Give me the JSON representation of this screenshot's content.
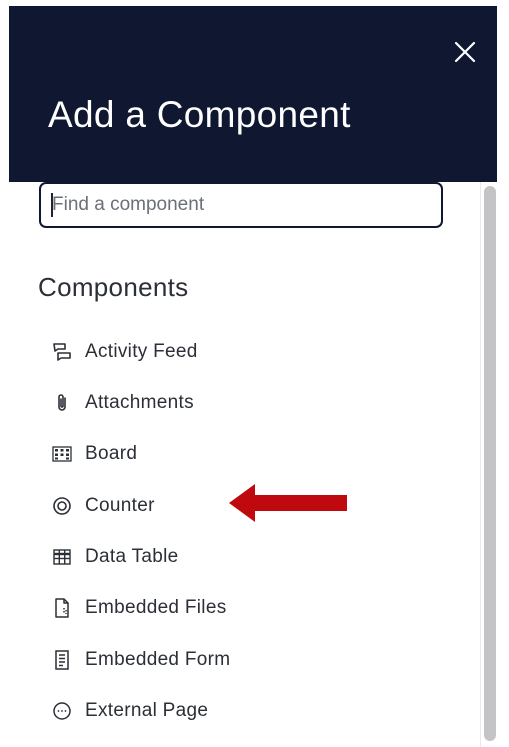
{
  "panel": {
    "title": "Add a Component",
    "close_icon": "close-icon",
    "header_color": "#0f1830"
  },
  "search": {
    "placeholder": "Find a component",
    "value": ""
  },
  "section": {
    "title": "Components"
  },
  "components": [
    {
      "label": "Activity Feed",
      "icon": "activity-feed-icon"
    },
    {
      "label": "Attachments",
      "icon": "paperclip-icon"
    },
    {
      "label": "Board",
      "icon": "board-icon"
    },
    {
      "label": "Counter",
      "icon": "counter-icon"
    },
    {
      "label": "Data Table",
      "icon": "table-icon"
    },
    {
      "label": "Embedded Files",
      "icon": "file-icon"
    },
    {
      "label": "Embedded Form",
      "icon": "form-icon"
    },
    {
      "label": "External Page",
      "icon": "external-page-icon"
    }
  ],
  "annotation": {
    "arrow_color": "#c0090f",
    "target": "Counter"
  }
}
